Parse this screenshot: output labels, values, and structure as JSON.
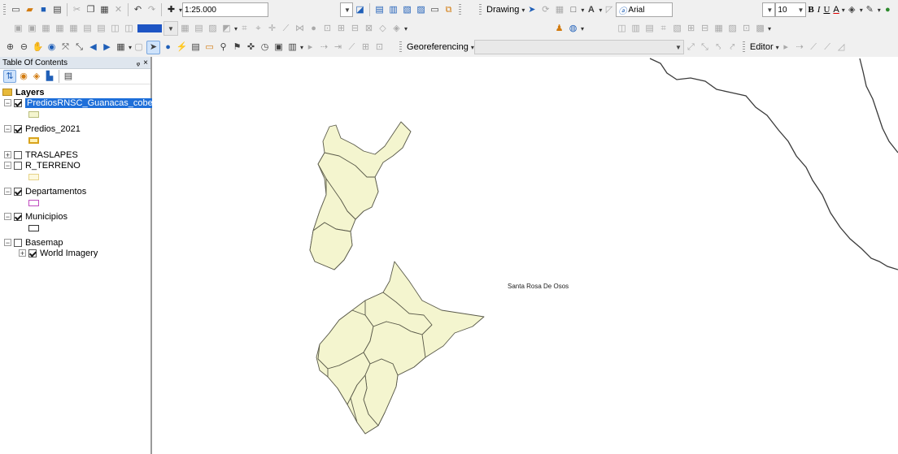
{
  "toolbar": {
    "scale_value": "1:25.000",
    "drawing_label": "Drawing",
    "font_name": "Arial",
    "font_size": "10",
    "bold_label": "B",
    "italic_label": "I",
    "underline_label": "U",
    "font_color_label": "A",
    "georeferencing_label": "Georeferencing",
    "editor_label": "Editor"
  },
  "toc": {
    "title": "Table Of Contents",
    "pin": "ᵩ",
    "close": "×",
    "layers_group": "Layers",
    "layers": [
      {
        "name": "PrediosRNSC_Guanacas_cobert",
        "checked": true,
        "swatch_border": "#b9bd7c",
        "swatch_fill": "#f4f5cf"
      },
      {
        "name": "Predios_2021",
        "checked": true,
        "swatch_border": "#d9a31c",
        "swatch_fill": "#fff1b5"
      },
      {
        "name": "TRASLAPES",
        "checked": false
      },
      {
        "name": "R_TERRENO",
        "checked": false,
        "swatch_border": "#e6d38a",
        "swatch_fill": "#fdf9df"
      },
      {
        "name": "Departamentos",
        "checked": true,
        "swatch_border": "#c04cc0",
        "swatch_fill": "#ffffff"
      },
      {
        "name": "Municipios",
        "checked": true,
        "swatch_border": "#333333",
        "swatch_fill": "#ffffff"
      },
      {
        "name": "Basemap",
        "checked": false
      },
      {
        "name": "World Imagery",
        "checked": true
      }
    ]
  },
  "map": {
    "label": "Santa Rosa De Osos",
    "polygon_fill": "#f4f5cf",
    "polygon_stroke": "#5a5a4a"
  }
}
